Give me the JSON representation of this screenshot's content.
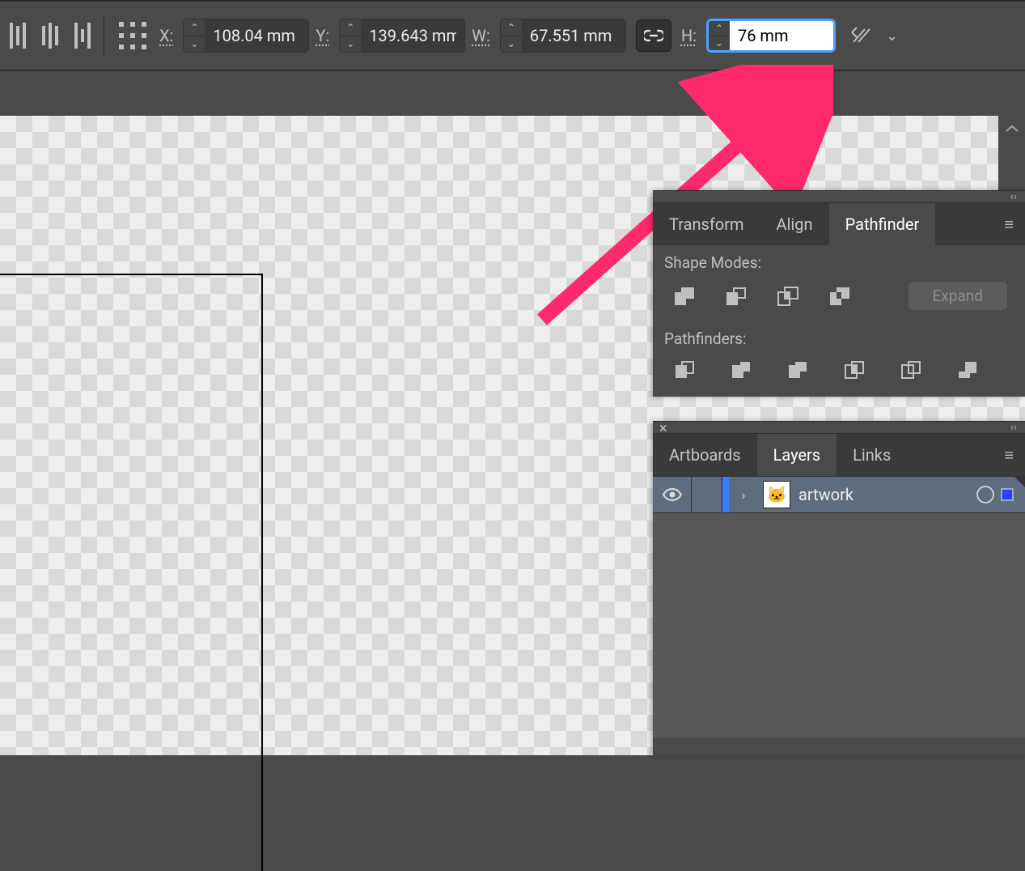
{
  "topbar": {
    "x_label": "X:",
    "y_label": "Y:",
    "w_label": "W:",
    "h_label": "H:",
    "x_value": "108.04 mm",
    "y_value": "139.643 mm",
    "w_value": "67.551 mm",
    "h_value": "76 mm"
  },
  "panel1": {
    "tabs": [
      "Transform",
      "Align",
      "Pathfinder"
    ],
    "active_tab": 2,
    "section_shape_modes": "Shape Modes:",
    "section_pathfinders": "Pathfinders:",
    "expand_label": "Expand"
  },
  "panel2": {
    "tabs": [
      "Artboards",
      "Layers",
      "Links"
    ],
    "active_tab": 1,
    "layer": {
      "name": "artwork"
    }
  }
}
